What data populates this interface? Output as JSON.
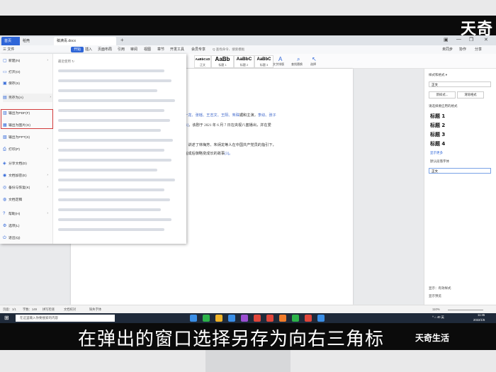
{
  "watermark": {
    "top": "天奇",
    "bottom": "天奇生活"
  },
  "tabs": {
    "home": "首页",
    "doc1": "稻壳",
    "doc2": "稿满青.docx",
    "plus": "+"
  },
  "window_controls": {
    "layout": "▣",
    "min": "—",
    "max": "❐",
    "close": "✕"
  },
  "menu": {
    "file": "三 文件",
    "items": [
      "开始",
      "插入",
      "页面布局",
      "引用",
      "审阅",
      "视图",
      "章节",
      "开发工具",
      "会员专享"
    ],
    "search": "Q 查找命令、搜索模板",
    "right": [
      "未同步",
      "协作",
      "分享"
    ]
  },
  "ribbon": {
    "styles": [
      {
        "sample": "AaBbCcD",
        "name": "正文"
      },
      {
        "sample": "AaBb",
        "name": "标题 1"
      },
      {
        "sample": "AaBbC",
        "name": "标题 2"
      },
      {
        "sample": "AaBbC",
        "name": "标题 3"
      }
    ],
    "tools": [
      {
        "icon": "A",
        "label": "文字排版"
      },
      {
        "icon": "⌕",
        "label": "查找替换"
      },
      {
        "icon": "↖",
        "label": "选择"
      }
    ]
  },
  "file_menu": {
    "items": [
      {
        "icon": "▢",
        "label": "新建(N)",
        "arrow": true
      },
      {
        "icon": "▭",
        "label": "打开(O)",
        "arrow": false
      },
      {
        "icon": "▣",
        "label": "保存(S)",
        "arrow": false
      },
      {
        "icon": "▤",
        "label": "另存为(A)",
        "arrow": true
      },
      {
        "icon": "▥",
        "label": "输出为PDF(F)",
        "arrow": false
      },
      {
        "icon": "▦",
        "label": "输出为图片(G)",
        "arrow": false
      },
      {
        "icon": "▧",
        "label": "输出为PPT(X)",
        "arrow": false
      },
      {
        "icon": "⎙",
        "label": "打印(P)",
        "arrow": true
      },
      {
        "icon": "◈",
        "label": "分享文档(D)",
        "arrow": false
      },
      {
        "icon": "◉",
        "label": "文档加密(E)",
        "arrow": true
      },
      {
        "icon": "◎",
        "label": "备份与恢复(K)",
        "arrow": true
      },
      {
        "icon": "◍",
        "label": "文档定稿",
        "arrow": false
      },
      {
        "icon": "?",
        "label": "帮助(H)",
        "arrow": true
      },
      {
        "icon": "⚙",
        "label": "选项(L)",
        "arrow": false
      },
      {
        "icon": "⏻",
        "label": "退出(Q)",
        "arrow": false
      }
    ],
    "recent_header": "最近使用 ↻"
  },
  "document": {
    "lines": [
      {
        "pre": "",
        "link": "一龙、张瑶、王志文、王阳、朱珠",
        "post": "媚和主演，",
        "link2": "李幼、张子"
      },
      {
        "pre": "",
        "link": "[1]",
        "post": "，该剧于 2021 年 6 月 7 日在央视八套播出，并在爱",
        "link2": ""
      },
      {
        "pre": "",
        "link": "",
        "post": "，讲述了林梅芳、朱炳龙等人在中国共产党员的指引下，",
        "link2": ""
      },
      {
        "pre": "",
        "link": "",
        "post": "完成后御略变成长的故事",
        "link2": "[3]。"
      }
    ]
  },
  "style_panel": {
    "header": "样式和格式 ▾",
    "current": "正文",
    "new_btn": "新样式...",
    "clear_btn": "清除格式",
    "apply_label": "请选择要应用的格式",
    "styles": [
      "标题 1",
      "标题 2",
      "标题 3",
      "标题 4"
    ],
    "more": "显示更多",
    "preview_label": "默认段落字体",
    "body": "正文",
    "show_label": "显示：有效样式",
    "show_preview": "显示预览"
  },
  "status_bar": {
    "page": "页面：1/1",
    "words": "字数：149",
    "spell": "拼写检查",
    "proof": "文档校对",
    "missing_font": "缺失字体",
    "zoom": "110%"
  },
  "taskbar": {
    "search": "在这里输入你要搜索的内容",
    "tray": "^  ⌂  40  英",
    "time": "11:45",
    "date": "2022/1/6"
  },
  "subtitle": "在弹出的窗口选择另存为向右三角标"
}
